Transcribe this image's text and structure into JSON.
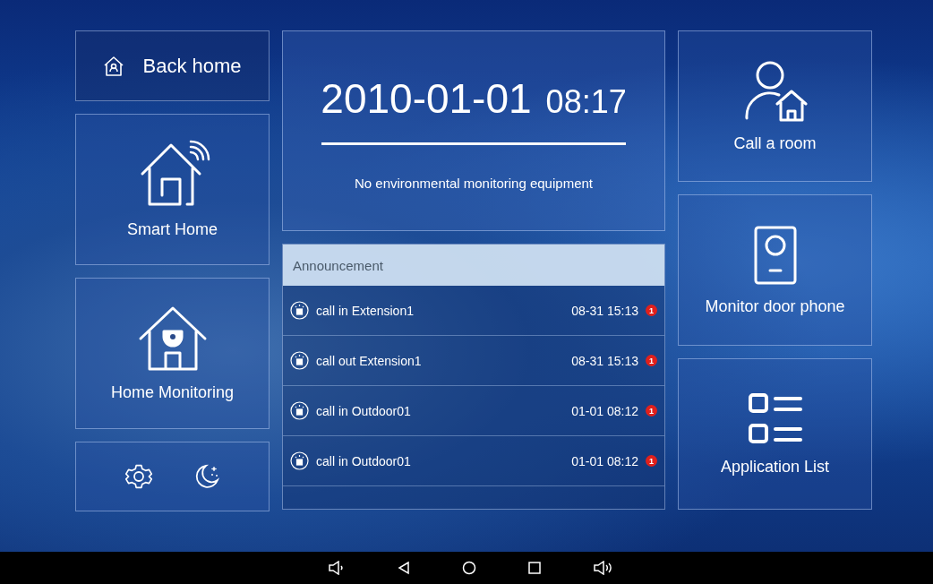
{
  "back_home": {
    "label": "Back home"
  },
  "left_tiles": [
    {
      "kind": "smart",
      "label": "Smart Home"
    },
    {
      "kind": "monitoring",
      "label": "Home Monitoring"
    }
  ],
  "clock": {
    "date": "2010-01-01",
    "time": "08:17",
    "status": "No environmental monitoring equipment"
  },
  "announcement": {
    "title": "Announcement",
    "rows": [
      {
        "text": "call in Extension1",
        "time": "08-31 15:13",
        "badge": "1"
      },
      {
        "text": "call out Extension1",
        "time": "08-31 15:13",
        "badge": "1"
      },
      {
        "text": "call in Outdoor01",
        "time": "01-01 08:12",
        "badge": "1"
      },
      {
        "text": "call in Outdoor01",
        "time": "01-01 08:12",
        "badge": "1"
      }
    ]
  },
  "right_tiles": [
    {
      "kind": "call",
      "label": "Call a room"
    },
    {
      "kind": "doorphone",
      "label": "Monitor door phone"
    },
    {
      "kind": "apps",
      "label": "Application List"
    }
  ]
}
